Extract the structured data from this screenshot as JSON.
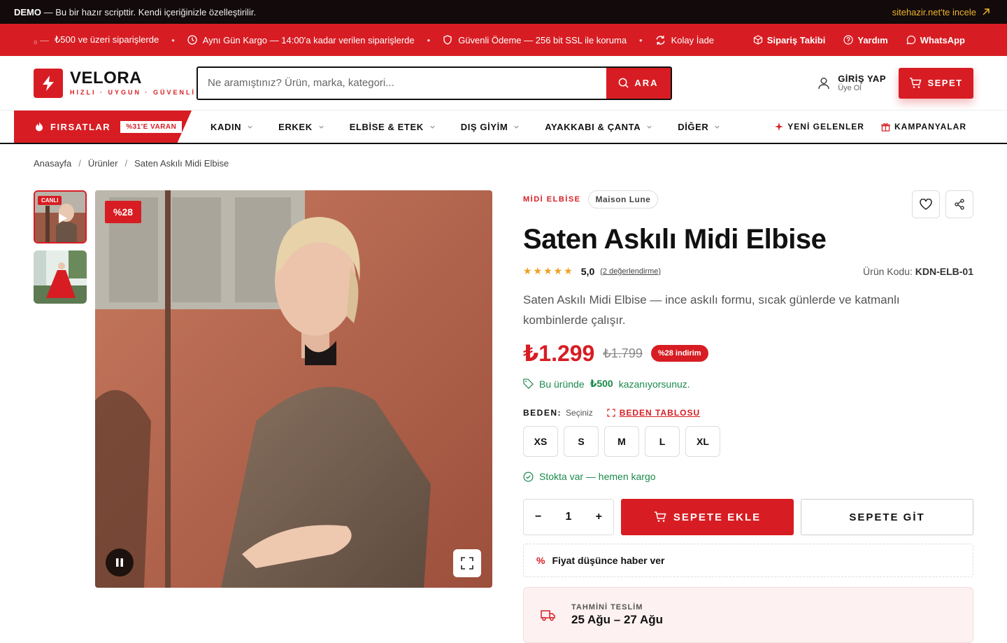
{
  "topbar": {
    "demo": "DEMO",
    "text": "— Bu bir hazır scripttir. Kendi içeriğinizle özelleştirilir.",
    "link": "sitehazir.net'te incele"
  },
  "promo": {
    "items": [
      "₺500 ve üzeri siparişlerde",
      "Aynı Gün Kargo — 14:00'a kadar verilen siparişlerde",
      "Güvenli Ödeme — 256 bit SSL ile koruma",
      "Kolay İade"
    ],
    "prefix": "₀ —",
    "links": [
      "Sipariş Takibi",
      "Yardım",
      "WhatsApp"
    ]
  },
  "header": {
    "brand": "VELORA",
    "tagline": "HIZLI · UYGUN · GÜVENLİ",
    "search_placeholder": "Ne aramıştınız? Ürün, marka, kategori...",
    "search_button": "ARA",
    "login_title": "GİRİŞ YAP",
    "login_sub": "Üye Ol",
    "cart": "SEPET"
  },
  "nav": {
    "deals": "FIRSATLAR",
    "deals_badge": "%31'E VARAN",
    "menu": [
      "KADIN",
      "ERKEK",
      "ELBİSE & ETEK",
      "DIŞ GİYİM",
      "AYAKKABI & ÇANTA",
      "DİĞER"
    ],
    "new": "YENİ GELENLER",
    "campaigns": "KAMPANYALAR"
  },
  "breadcrumb": [
    "Anasayfa",
    "Ürünler",
    "Saten Askılı Midi Elbise"
  ],
  "gallery": {
    "live_badge": "CANLI",
    "discount": "%28"
  },
  "product": {
    "category": "MİDİ ELBİSE",
    "brand": "Maison Lune",
    "title": "Saten Askılı Midi Elbise",
    "stars": "★★★★★",
    "rating": "5,0",
    "reviews": "(2 değerlendirme)",
    "code_label": "Ürün Kodu:",
    "code": "KDN-ELB-01",
    "description": "Saten Askılı Midi Elbise — ince askılı formu, sıcak günlerde ve katmanlı kombinlerde çalışır.",
    "price": "₺1.299",
    "old_price": "₺1.799",
    "discount_badge": "%28 indirim",
    "save_pre": "Bu üründe",
    "save_amount": "₺500",
    "save_post": "kazanıyorsunuz.",
    "size_label": "BEDEN:",
    "size_selected": "Seçiniz",
    "size_guide": "BEDEN TABLOSU",
    "sizes": [
      "XS",
      "S",
      "M",
      "L",
      "XL"
    ],
    "stock": "Stokta var — hemen kargo",
    "qty": "1",
    "add_to_cart": "SEPETE EKLE",
    "go_cart": "SEPETE GİT",
    "price_alert": "Fiyat düşünce haber ver",
    "delivery_label": "TAHMİNİ TESLİM",
    "delivery_dates": "25 Ağu – 27 Ağu"
  },
  "colors": {
    "accent": "#d71d23",
    "dark": "#120a0b",
    "success": "#1a8a4c",
    "star": "#f0a020"
  }
}
